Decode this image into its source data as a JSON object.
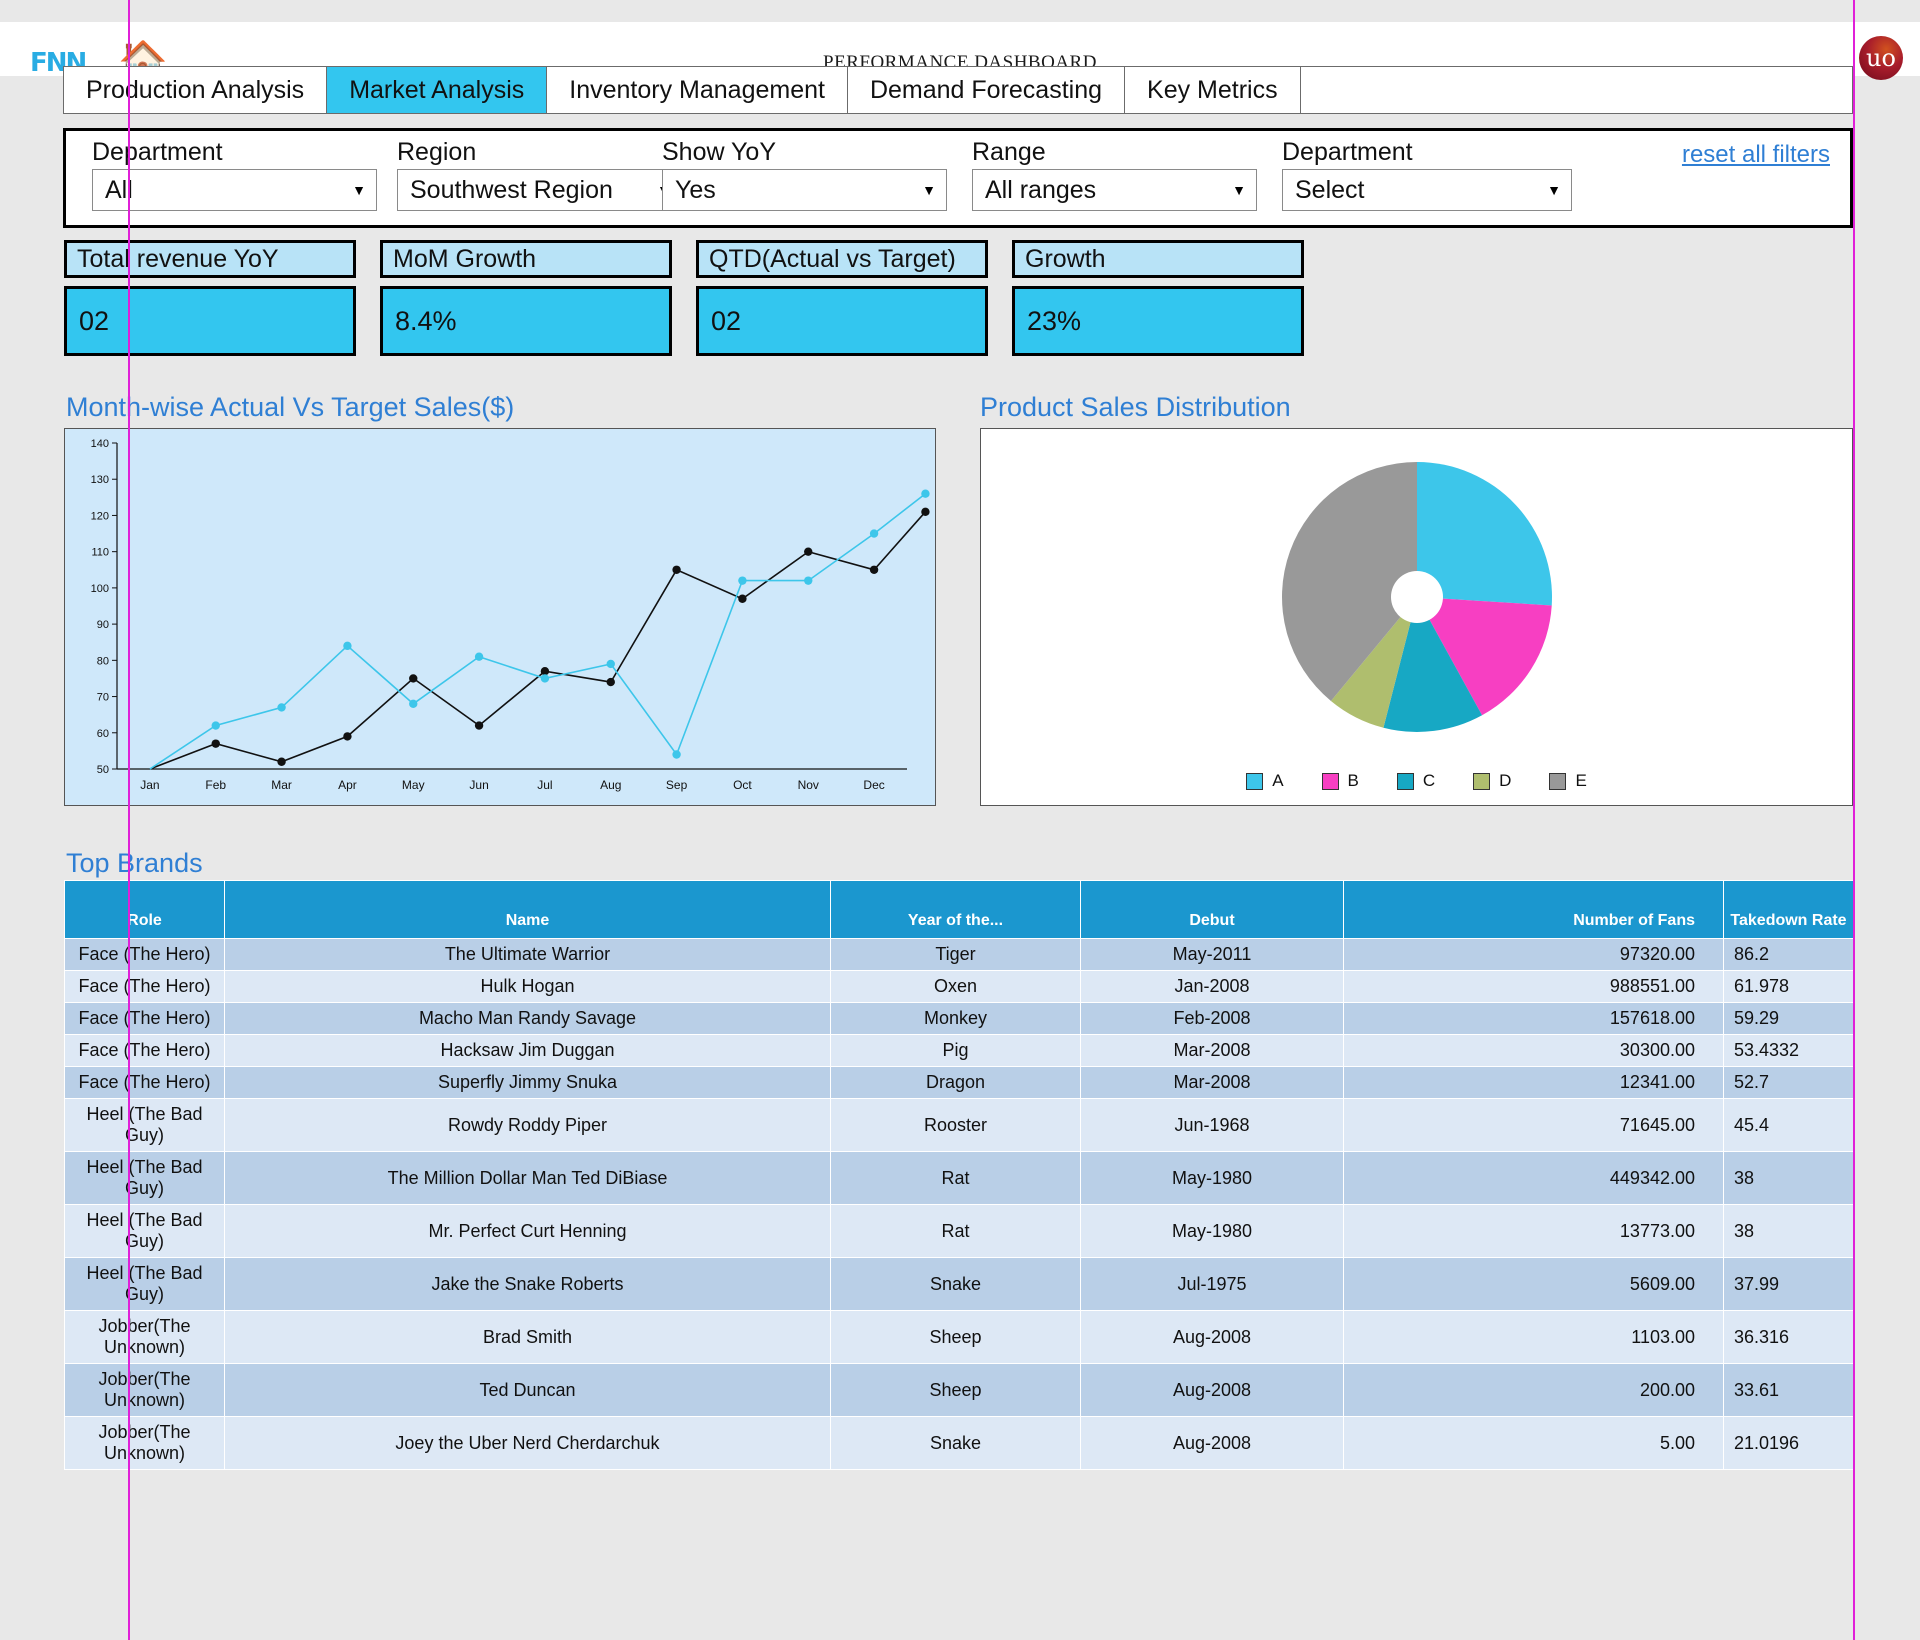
{
  "header": {
    "logo_text": "FNN",
    "home_icon": "house-icon",
    "title": "PERFORMANCE DASHBOARD",
    "brand_logo_text": "uo"
  },
  "tabs": [
    {
      "label": "Production Analysis",
      "active": false
    },
    {
      "label": "Market Analysis",
      "active": true
    },
    {
      "label": "Inventory Management",
      "active": false
    },
    {
      "label": "Demand Forecasting",
      "active": false
    },
    {
      "label": "Key Metrics",
      "active": false
    }
  ],
  "filters": {
    "reset_label": "reset all filters",
    "items": [
      {
        "label": "Department",
        "value": "All"
      },
      {
        "label": "Region",
        "value": "Southwest Region"
      },
      {
        "label": "Show YoY",
        "value": "Yes"
      },
      {
        "label": "Range",
        "value": "All ranges"
      },
      {
        "label": "Department",
        "value": "Select"
      }
    ]
  },
  "kpis": [
    {
      "title": "Total revenue YoY",
      "value": "02"
    },
    {
      "title": "MoM Growth",
      "value": "8.4%"
    },
    {
      "title": "QTD(Actual vs Target)",
      "value": "02"
    },
    {
      "title": "Growth",
      "value": "23%"
    }
  ],
  "sections": {
    "line_title": "Month-wise Actual Vs Target Sales($)",
    "pie_title": "Product Sales Distribution",
    "table_title": "Top Brands"
  },
  "chart_data": [
    {
      "type": "line",
      "title": "Month-wise Actual Vs Target Sales($)",
      "xlabel": "",
      "ylabel": "",
      "ylim": [
        50,
        140
      ],
      "yticks": [
        50,
        60,
        70,
        80,
        90,
        100,
        110,
        120,
        130,
        140
      ],
      "grid": false,
      "legend": "none",
      "categories": [
        "Jan",
        "Feb",
        "Mar",
        "Apr",
        "May",
        "Jun",
        "Jul",
        "Aug",
        "Sep",
        "Oct",
        "Nov",
        "Dec"
      ],
      "series": [
        {
          "name": "Actual",
          "color": "#111111",
          "values": [
            50,
            57,
            52,
            59,
            75,
            62,
            77,
            74,
            105,
            97,
            110,
            105
          ]
        },
        {
          "name": "Target",
          "color": "#3DC6EA",
          "values": [
            50,
            62,
            67,
            84,
            68,
            81,
            75,
            79,
            54,
            102,
            102,
            115
          ]
        }
      ],
      "series_last_points": [
        {
          "name": "Actual",
          "x": "Dec",
          "y": 121
        },
        {
          "name": "Target",
          "x": "Dec",
          "y": 126
        }
      ]
    },
    {
      "type": "pie",
      "title": "Product Sales Distribution",
      "donut_hole": true,
      "legend_position": "bottom",
      "labels": [
        "A",
        "B",
        "C",
        "D",
        "E"
      ],
      "values": [
        26,
        16,
        12,
        7,
        39
      ],
      "colors": [
        "#3DC6EA",
        "#F73FC2",
        "#17A8C4",
        "#AFBE6E",
        "#999999"
      ]
    }
  ],
  "table": {
    "title": "Top Brands",
    "columns": [
      "Role",
      "Name",
      "Year of the...",
      "Debut",
      "Number of Fans",
      "Takedown Rate"
    ],
    "rows": [
      [
        "Face (The Hero)",
        "The Ultimate Warrior",
        "Tiger",
        "May-2011",
        "97320.00",
        "86.2"
      ],
      [
        "Face (The Hero)",
        "Hulk Hogan",
        "Oxen",
        "Jan-2008",
        "988551.00",
        "61.978"
      ],
      [
        "Face (The Hero)",
        "Macho Man Randy Savage",
        "Monkey",
        "Feb-2008",
        "157618.00",
        "59.29"
      ],
      [
        "Face (The Hero)",
        "Hacksaw Jim Duggan",
        "Pig",
        "Mar-2008",
        "30300.00",
        "53.4332"
      ],
      [
        "Face (The Hero)",
        "Superfly Jimmy Snuka",
        "Dragon",
        "Mar-2008",
        "12341.00",
        "52.7"
      ],
      [
        "Heel (The Bad Guy)",
        "Rowdy Roddy Piper",
        "Rooster",
        "Jun-1968",
        "71645.00",
        "45.4"
      ],
      [
        "Heel (The Bad Guy)",
        "The Million Dollar Man Ted DiBiase",
        "Rat",
        "May-1980",
        "449342.00",
        "38"
      ],
      [
        "Heel (The Bad Guy)",
        "Mr. Perfect Curt Henning",
        "Rat",
        "May-1980",
        "13773.00",
        "38"
      ],
      [
        "Heel (The Bad Guy)",
        "Jake the Snake Roberts",
        "Snake",
        "Jul-1975",
        "5609.00",
        "37.99"
      ],
      [
        "Jobber(The Unknown)",
        "Brad Smith",
        "Sheep",
        "Aug-2008",
        "1103.00",
        "36.316"
      ],
      [
        "Jobber(The Unknown)",
        "Ted Duncan",
        "Sheep",
        "Aug-2008",
        "200.00",
        "33.61"
      ],
      [
        "Jobber(The Unknown)",
        "Joey the Uber Nerd Cherdarchuk",
        "Snake",
        "Aug-2008",
        "5.00",
        "21.0196"
      ]
    ]
  },
  "colors": {
    "accent": "#33c6ef",
    "link": "#2f7fd4",
    "table_header": "#1b97cf",
    "frame": "#e020d8"
  }
}
